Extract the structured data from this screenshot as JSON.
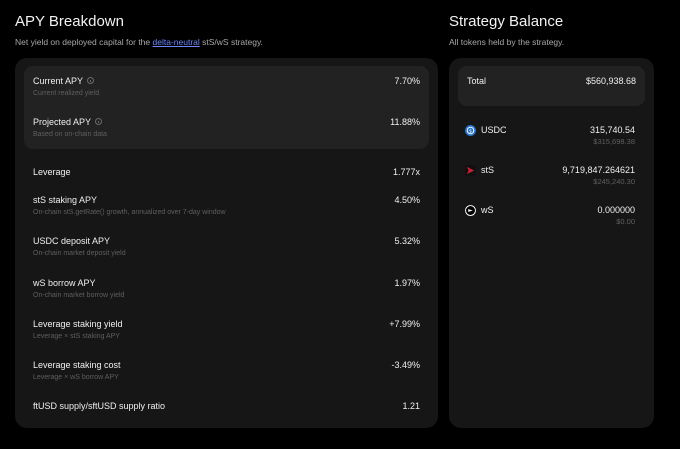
{
  "apy": {
    "title": "APY Breakdown",
    "subtitle_prefix": "Net yield on deployed capital for the ",
    "subtitle_link": "delta-neutral",
    "subtitle_suffix": " stS/wS strategy.",
    "current": {
      "label": "Current APY",
      "sub": "Current realized yield",
      "value": "7.70%"
    },
    "projected": {
      "label": "Projected APY",
      "sub": "Based on on-chain data",
      "value": "11.88%"
    },
    "rows": [
      {
        "label": "Leverage",
        "sub": "",
        "value": "1.777x"
      },
      {
        "label": "stS staking APY",
        "sub": "On-chain stS.getRate() growth, annualized over 7-day window",
        "value": "4.50%"
      },
      {
        "label": "USDC deposit APY",
        "sub": "On-chain market deposit yield",
        "value": "5.32%"
      },
      {
        "label": "wS borrow APY",
        "sub": "On-chain market borrow yield",
        "value": "1.97%"
      },
      {
        "label": "Leverage staking yield",
        "sub": "Leverage × stS staking APY",
        "value": "+7.99%"
      },
      {
        "label": "Leverage staking cost",
        "sub": "Leverage × wS borrow APY",
        "value": "-3.49%"
      },
      {
        "label": "ftUSD supply/sftUSD supply ratio",
        "sub": "",
        "value": "1.21"
      }
    ]
  },
  "balance": {
    "title": "Strategy Balance",
    "subtitle": "All tokens held by the strategy.",
    "total_label": "Total",
    "total_value": "$560,938.68",
    "tokens": [
      {
        "name": "USDC",
        "amount": "315,740.54",
        "usd": "$315,698.38",
        "icon": "usdc-icon",
        "color": "#2775ca"
      },
      {
        "name": "stS",
        "amount": "9,719,847.264621",
        "usd": "$245,240.30",
        "icon": "sts-icon",
        "color": "#c0182b"
      },
      {
        "name": "wS",
        "amount": "0.000000",
        "usd": "$0.00",
        "icon": "ws-icon",
        "color": "#ffffff"
      }
    ]
  }
}
